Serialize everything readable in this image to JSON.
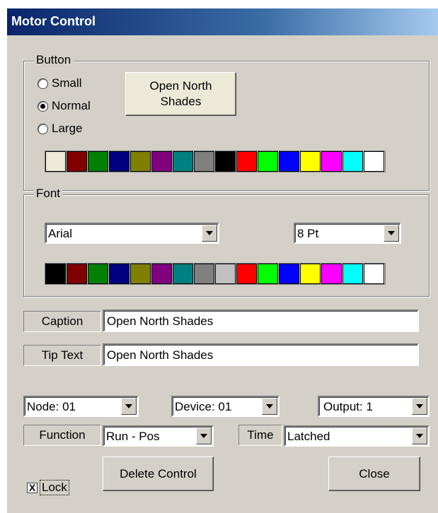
{
  "window": {
    "title": "Motor Control"
  },
  "button_group": {
    "legend": "Button",
    "sizes": [
      {
        "label": "Small",
        "checked": false
      },
      {
        "label": "Normal",
        "checked": true
      },
      {
        "label": "Large",
        "checked": false
      }
    ],
    "preview_label_line1": "Open North",
    "preview_label_line2": "Shades",
    "colors": [
      "#ece9d8",
      "#800000",
      "#008000",
      "#000080",
      "#808000",
      "#800080",
      "#008080",
      "#808080",
      "#000000",
      "#ff0000",
      "#00ff00",
      "#0000ff",
      "#ffff00",
      "#ff00ff",
      "#00ffff",
      "#ffffff"
    ]
  },
  "font_group": {
    "legend": "Font",
    "font_name": "Arial",
    "font_size": "8 Pt",
    "colors": [
      "#000000",
      "#800000",
      "#008000",
      "#000080",
      "#808000",
      "#800080",
      "#008080",
      "#808080",
      "#c0c0c0",
      "#ff0000",
      "#00ff00",
      "#0000ff",
      "#ffff00",
      "#ff00ff",
      "#00ffff",
      "#ffffff"
    ]
  },
  "caption": {
    "label": "Caption",
    "value": "Open North Shades"
  },
  "tip_text": {
    "label": "Tip Text",
    "value": "Open North Shades"
  },
  "selectors": {
    "node": "Node: 01",
    "device": "Device: 01",
    "output": "Output: 1"
  },
  "function": {
    "label": "Function",
    "value": "Run - Pos"
  },
  "time": {
    "label": "Time",
    "value": "Latched"
  },
  "lock": {
    "label": "Lock",
    "checked": true,
    "mark": "X"
  },
  "actions": {
    "delete_label": "Delete Control",
    "close_label": "Close"
  }
}
